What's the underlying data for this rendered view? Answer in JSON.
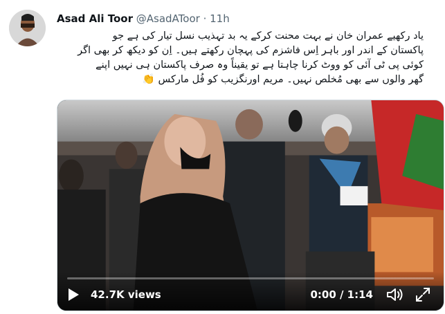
{
  "tweet": {
    "author_name": "Asad Ali Toor",
    "handle": "@AsadAToor",
    "separator": "·",
    "time": "11h",
    "text_lines": [
      "یاد رکھیے عمران خان نے بہت محنت کرکے یہ بد تہذیب نسل تیار کی ہے جو",
      "پاکستان کے اندر اور باہر اِس فاشزم کی پہچان رکھتے ہیں۔ اِن کو دیکھ کر بھی اگر",
      "کوئی پی ٹی آئی کو ووٹ کرنا چاہتا ہے تو یقیناً وہ صرف پاکستان ہی نہیں اپنے",
      "گھر والوں سے بھی مُخلص نہیں۔ مریم اورنگزیب کو فُل مارکس 👏"
    ]
  },
  "video": {
    "views": "42.7K views",
    "timecode": "0:00 / 1:14",
    "progress": 0.0,
    "accent": "#1d9bf0",
    "icons": [
      "play-icon",
      "volume-icon",
      "fullscreen-icon"
    ]
  }
}
